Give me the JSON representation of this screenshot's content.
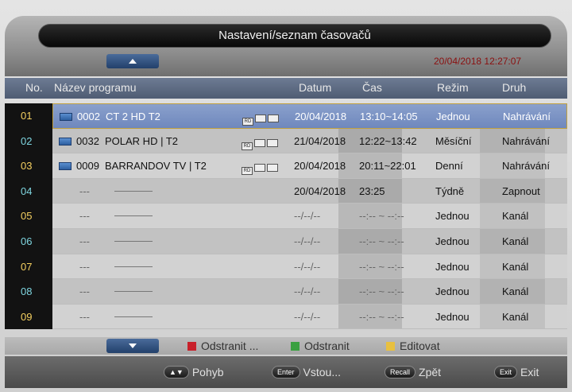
{
  "title": "Nastavení/seznam časovačů",
  "datetime": "20/04/2018 12:27:07",
  "headers": {
    "no": "No.",
    "program": "Název programu",
    "datum": "Datum",
    "cas": "Čas",
    "rezim": "Režim",
    "druh": "Druh"
  },
  "rows": [
    {
      "no": "01",
      "ch": "0002",
      "name": "CT 2 HD T2",
      "datum": "20/04/2018",
      "cas": "13:10~14:05",
      "rezim": "Jednou",
      "druh": "Nahrávání",
      "selected": true,
      "has_icon": true
    },
    {
      "no": "02",
      "ch": "0032",
      "name": "POLAR HD | T2",
      "datum": "21/04/2018",
      "cas": "12:22~13:42",
      "rezim": "Měsíční",
      "druh": "Nahrávání",
      "has_icon": true
    },
    {
      "no": "03",
      "ch": "0009",
      "name": "BARRANDOV TV | T2",
      "datum": "20/04/2018",
      "cas": "20:11~22:01",
      "rezim": "Denní",
      "druh": "Nahrávání",
      "has_icon": true
    },
    {
      "no": "04",
      "ch": "---",
      "name": "",
      "datum": "20/04/2018",
      "cas": "23:25",
      "rezim": "Týdně",
      "druh": "Zapnout"
    },
    {
      "no": "05",
      "ch": "---",
      "name": "",
      "datum": "--/--/--",
      "cas": "--:-- ~ --:--",
      "rezim": "Jednou",
      "druh": "Kanál"
    },
    {
      "no": "06",
      "ch": "---",
      "name": "",
      "datum": "--/--/--",
      "cas": "--:-- ~ --:--",
      "rezim": "Jednou",
      "druh": "Kanál"
    },
    {
      "no": "07",
      "ch": "---",
      "name": "",
      "datum": "--/--/--",
      "cas": "--:-- ~ --:--",
      "rezim": "Jednou",
      "druh": "Kanál"
    },
    {
      "no": "08",
      "ch": "---",
      "name": "",
      "datum": "--/--/--",
      "cas": "--:-- ~ --:--",
      "rezim": "Jednou",
      "druh": "Kanál"
    },
    {
      "no": "09",
      "ch": "---",
      "name": "",
      "datum": "--/--/--",
      "cas": "--:-- ~ --:--",
      "rezim": "Jednou",
      "druh": "Kanál"
    }
  ],
  "badges": [
    "RD",
    "",
    ""
  ],
  "legend": {
    "red": {
      "label": "Odstranit ...",
      "color": "#c8202a"
    },
    "green": {
      "label": "Odstranit",
      "color": "#3aa040"
    },
    "yellow": {
      "label": "Editovat",
      "color": "#e8c040"
    }
  },
  "footer": {
    "move": {
      "key": "▲▼",
      "label": "Pohyb"
    },
    "enter": {
      "key": "Enter",
      "label": "Vstou..."
    },
    "recall": {
      "key": "Recall",
      "label": "Zpět"
    },
    "exit": {
      "key": "Exit",
      "label": "Exit"
    }
  }
}
